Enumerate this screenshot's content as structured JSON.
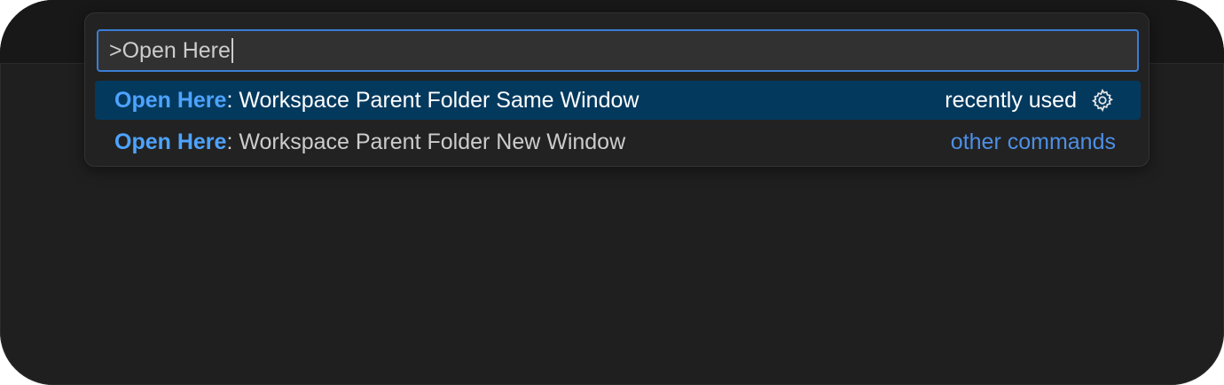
{
  "command_palette": {
    "input_value": ">Open Here",
    "items": [
      {
        "highlight": "Open Here",
        "label": ": Workspace Parent Folder Same Window",
        "detail": "recently used",
        "icon": "gear-icon"
      },
      {
        "highlight": "Open Here",
        "label": ": Workspace Parent Folder New Window",
        "detail": "other commands"
      }
    ]
  },
  "colors": {
    "window_bg": "#1f1f1f",
    "selection_bg": "#04395e",
    "highlight": "#4da3ff",
    "focus_border": "#3a7dd6"
  }
}
